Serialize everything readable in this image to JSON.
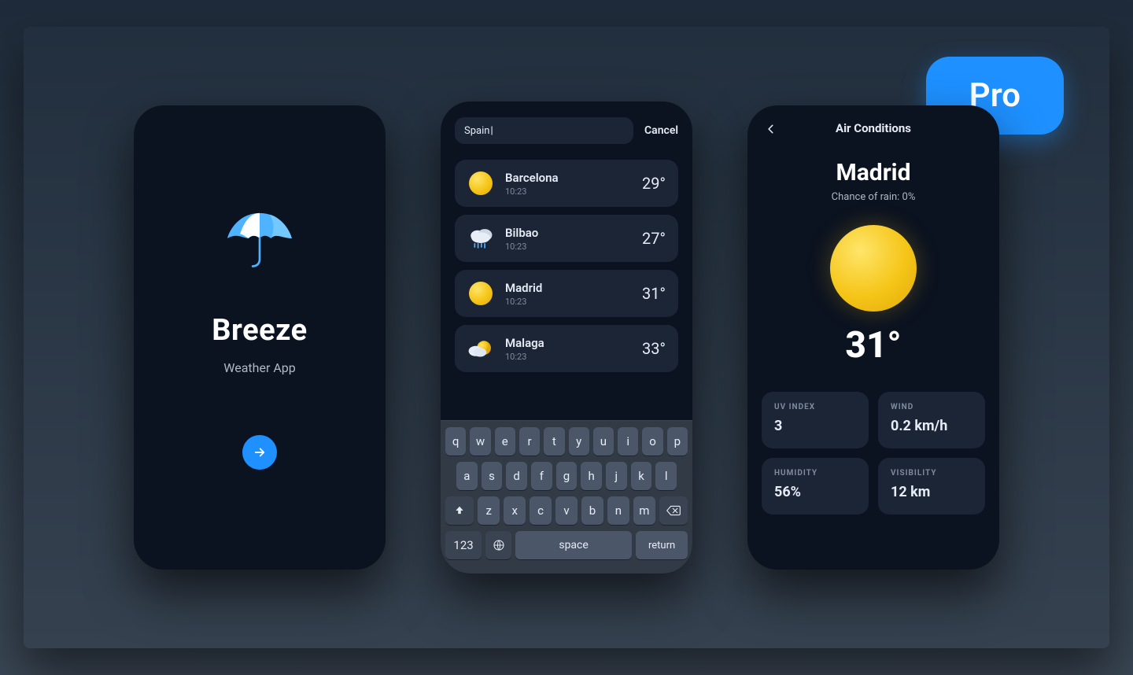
{
  "badge": {
    "label": "Pro"
  },
  "splash": {
    "title": "Breeze",
    "subtitle": "Weather App"
  },
  "search": {
    "query": "Spain",
    "cancel_label": "Cancel",
    "results": [
      {
        "city": "Barcelona",
        "time": "10:23",
        "temp": "29°",
        "icon": "sun"
      },
      {
        "city": "Bilbao",
        "time": "10:23",
        "temp": "27°",
        "icon": "rain"
      },
      {
        "city": "Madrid",
        "time": "10:23",
        "temp": "31°",
        "icon": "sun"
      },
      {
        "city": "Malaga",
        "time": "10:23",
        "temp": "33°",
        "icon": "sun-cloud"
      }
    ],
    "keyboard": {
      "row1": [
        "q",
        "w",
        "e",
        "r",
        "t",
        "y",
        "u",
        "i",
        "o",
        "p"
      ],
      "row2": [
        "a",
        "s",
        "d",
        "f",
        "g",
        "h",
        "j",
        "k",
        "l"
      ],
      "row3": [
        "z",
        "x",
        "c",
        "v",
        "b",
        "n",
        "m"
      ],
      "number_key": "123",
      "space_label": "space",
      "return_label": "return"
    }
  },
  "detail": {
    "header": "Air Conditions",
    "city": "Madrid",
    "rain_text": "Chance of rain: 0%",
    "temp": "31°",
    "stats": [
      {
        "label": "UV INDEX",
        "value": "3"
      },
      {
        "label": "WIND",
        "value": "0.2 km/h"
      },
      {
        "label": "HUMIDITY",
        "value": "56%"
      },
      {
        "label": "VISIBILITY",
        "value": "12 km"
      }
    ]
  }
}
